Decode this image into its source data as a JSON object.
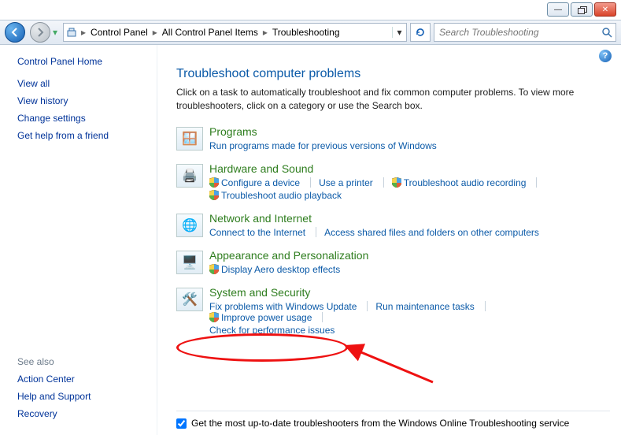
{
  "breadcrumb": {
    "items": [
      "Control Panel",
      "All Control Panel Items",
      "Troubleshooting"
    ]
  },
  "search": {
    "placeholder": "Search Troubleshooting"
  },
  "sidebar": {
    "home": "Control Panel Home",
    "links": [
      "View all",
      "View history",
      "Change settings",
      "Get help from a friend"
    ],
    "seealso_head": "See also",
    "seealso": [
      "Action Center",
      "Help and Support",
      "Recovery"
    ]
  },
  "page": {
    "title": "Troubleshoot computer problems",
    "desc": "Click on a task to automatically troubleshoot and fix common computer problems. To view more troubleshooters, click on a category or use the Search box."
  },
  "categories": [
    {
      "title": "Programs",
      "tasks": [
        {
          "label": "Run programs made for previous versions of Windows",
          "shield": false
        }
      ]
    },
    {
      "title": "Hardware and Sound",
      "tasks": [
        {
          "label": "Configure a device",
          "shield": true
        },
        {
          "label": "Use a printer",
          "shield": false
        },
        {
          "label": "Troubleshoot audio recording",
          "shield": true
        },
        {
          "label": "Troubleshoot audio playback",
          "shield": true,
          "break_before": true
        }
      ]
    },
    {
      "title": "Network and Internet",
      "tasks": [
        {
          "label": "Connect to the Internet",
          "shield": false
        },
        {
          "label": "Access shared files and folders on other computers",
          "shield": false
        }
      ]
    },
    {
      "title": "Appearance and Personalization",
      "tasks": [
        {
          "label": "Display Aero desktop effects",
          "shield": true
        }
      ]
    },
    {
      "title": "System and Security",
      "tasks": [
        {
          "label": "Fix problems with Windows Update",
          "shield": false
        },
        {
          "label": "Run maintenance tasks",
          "shield": false
        },
        {
          "label": "Improve power usage",
          "shield": true
        },
        {
          "label": "Check for performance issues",
          "shield": false,
          "break_before": true
        }
      ]
    }
  ],
  "footer": {
    "checkbox_label": "Get the most up-to-date troubleshooters from the Windows Online Troubleshooting service"
  }
}
